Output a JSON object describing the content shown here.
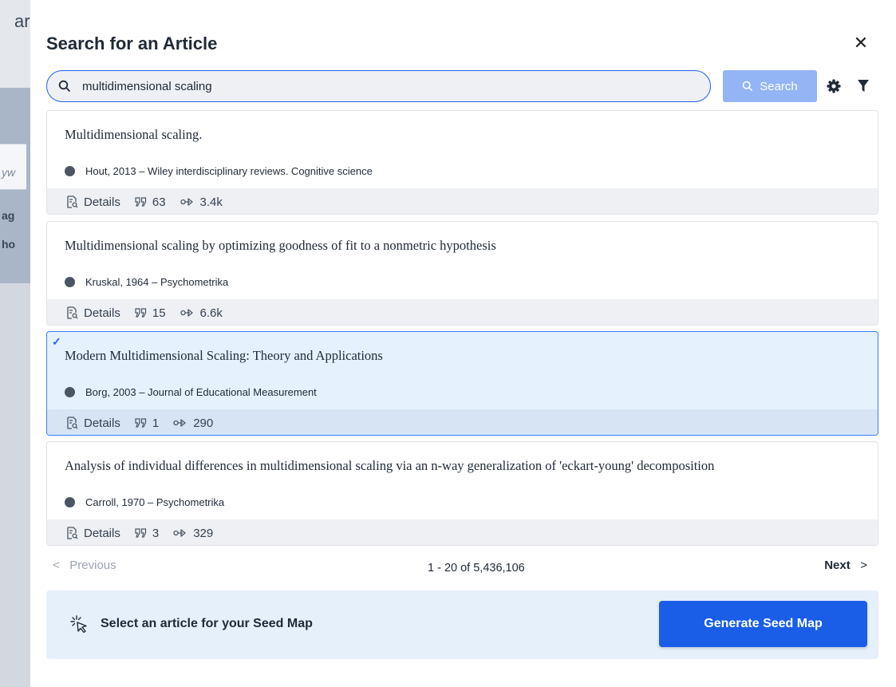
{
  "background": {
    "title_fragment": "ar",
    "field_fragment": "yw",
    "line1_fragment": "ag",
    "line2_fragment": "ho"
  },
  "modal": {
    "title": "Search for an Article",
    "close_icon": "close-icon"
  },
  "search": {
    "value": "multidimensional scaling",
    "button_label": "Search"
  },
  "results": [
    {
      "title": "Multidimensional scaling.",
      "meta": "Hout, 2013 – Wiley interdisciplinary reviews. Cognitive science",
      "details_label": "Details",
      "references": "63",
      "citations": "3.4k",
      "selected": false
    },
    {
      "title": "Multidimensional scaling by optimizing goodness of fit to a nonmetric hypothesis",
      "meta": "Kruskal, 1964 – Psychometrika",
      "details_label": "Details",
      "references": "15",
      "citations": "6.6k",
      "selected": false
    },
    {
      "title": "Modern Multidimensional Scaling: Theory and Applications",
      "meta": "Borg, 2003 – Journal of Educational Measurement",
      "details_label": "Details",
      "references": "1",
      "citations": "290",
      "selected": true
    },
    {
      "title": "Analysis of individual differences in multidimensional scaling via an n-way generalization of 'eckart-young' decomposition",
      "meta": "Carroll, 1970 – Psychometrika",
      "details_label": "Details",
      "references": "3",
      "citations": "329",
      "selected": false
    }
  ],
  "pagination": {
    "previous_label": "Previous",
    "range_text": "1 - 20 of 5,436,106",
    "next_label": "Next"
  },
  "footer": {
    "hint": "Select an article for your Seed Map",
    "generate_label": "Generate Seed Map"
  },
  "colors": {
    "accent": "#1a5ee8",
    "selected_bg": "#e5f1fd",
    "search_button": "#93b4f5"
  }
}
